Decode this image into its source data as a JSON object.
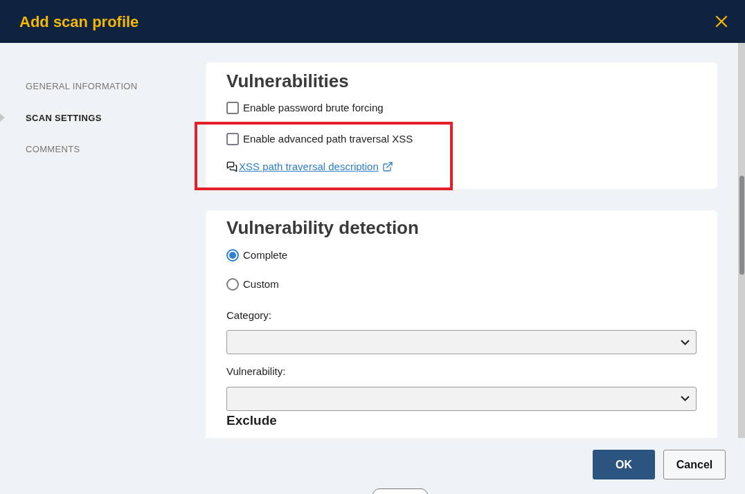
{
  "dialog": {
    "title": "Add scan profile"
  },
  "sidebar": {
    "items": [
      {
        "label": "GENERAL INFORMATION",
        "selected": false
      },
      {
        "label": "SCAN SETTINGS",
        "selected": true
      },
      {
        "label": "COMMENTS",
        "selected": false
      }
    ]
  },
  "vulnerabilities": {
    "title": "Vulnerabilities",
    "options": [
      {
        "label": "Enable password brute forcing",
        "checked": false
      },
      {
        "label": "Enable advanced path traversal XSS",
        "checked": false
      }
    ],
    "link": "XSS path traversal description"
  },
  "detection": {
    "title": "Vulnerability detection",
    "modes": [
      {
        "label": "Complete",
        "selected": true
      },
      {
        "label": "Custom",
        "selected": false
      }
    ],
    "fields": [
      {
        "label": "Category:"
      },
      {
        "label": "Vulnerability:"
      }
    ],
    "exclude_heading": "Exclude"
  },
  "buttons": {
    "ok": "OK",
    "cancel": "Cancel"
  }
}
